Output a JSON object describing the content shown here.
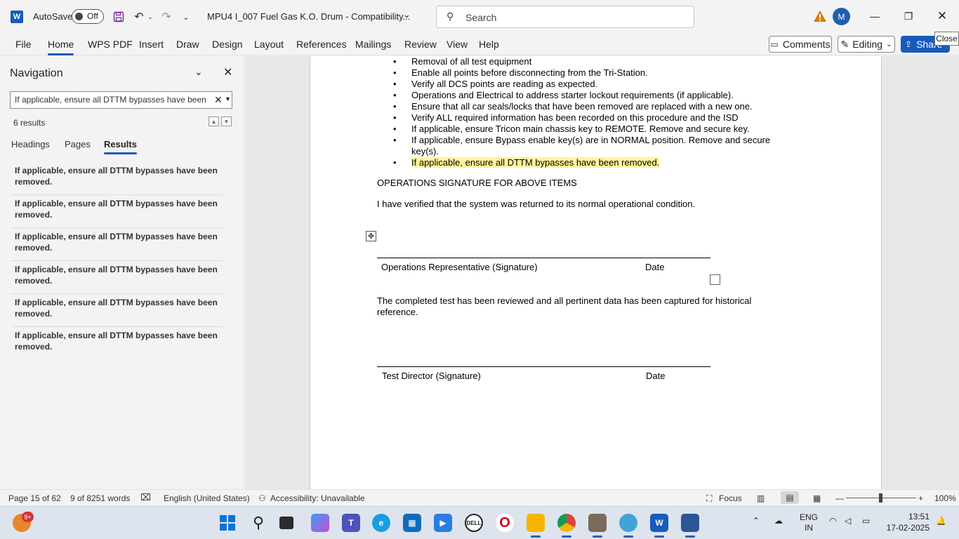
{
  "titlebar": {
    "autosave_label": "AutoSave",
    "autosave_state": "Off",
    "doc_title": "MPU4 I_007 Fuel Gas K.O. Drum  -  Compatibility...",
    "search_placeholder": "Search",
    "avatar_initial": "M"
  },
  "ribbon": {
    "tabs": [
      "File",
      "Home",
      "WPS PDF",
      "Insert",
      "Draw",
      "Design",
      "Layout",
      "References",
      "Mailings",
      "Review",
      "View",
      "Help"
    ],
    "active_tab": "Home",
    "comments_label": "Comments",
    "editing_label": "Editing",
    "share_label": "Share",
    "tooltip": "Close"
  },
  "navigation": {
    "title": "Navigation",
    "search_value": "If applicable, ensure all DTTM bypasses have been removed.",
    "results_count": "6 results",
    "tabs": [
      "Headings",
      "Pages",
      "Results"
    ],
    "active_tab": "Results",
    "results": [
      "If applicable, ensure all DTTM bypasses have been removed.",
      "If applicable, ensure all DTTM bypasses have been removed.",
      "If applicable, ensure all DTTM bypasses have been removed.",
      "If applicable, ensure all DTTM bypasses have been removed.",
      "If applicable, ensure all DTTM bypasses have been removed.",
      "If applicable, ensure all DTTM bypasses have been removed."
    ]
  },
  "document": {
    "bullets": [
      "Removal of all test equipment",
      "Enable all points before disconnecting from the Tri-Station.",
      "Verify all DCS points are reading as expected.",
      "Operations and Electrical to address starter lockout requirements (if applicable).",
      "Ensure that all car seals/locks that have been removed are replaced with a new one.",
      "Verify ALL required information has been recorded on this procedure and the ISD",
      "If applicable, ensure Tricon main chassis key to REMOTE. Remove and secure key.",
      "If applicable, ensure Bypass enable key(s) are in NORMAL position. Remove and secure key(s).",
      "If applicable, ensure all DTTM bypasses have been removed."
    ],
    "highlighted_index": 8,
    "section_heading": "OPERATIONS SIGNATURE FOR ABOVE ITEMS",
    "verify_text": "I have verified that the system was returned to its normal operational condition.",
    "sig1_label": "Operations Representative (Signature)",
    "sig1_date": "Date",
    "reviewed_text": "The completed test has been reviewed and all pertinent data has been captured for historical reference.",
    "sig2_label": "Test Director (Signature)",
    "sig2_date": "Date"
  },
  "statusbar": {
    "page": "Page 15 of 62",
    "words": "9 of 8251 words",
    "language": "English (United States)",
    "accessibility": "Accessibility: Unavailable",
    "focus": "Focus",
    "zoom": "100%"
  },
  "taskbar": {
    "notification_badge": "9+",
    "lang_line1": "ENG",
    "lang_line2": "IN",
    "time": "13:51",
    "date": "17-02-2025"
  },
  "colors": {
    "accent": "#185abd",
    "highlight": "#fff59a",
    "warning": "#d97b00"
  }
}
